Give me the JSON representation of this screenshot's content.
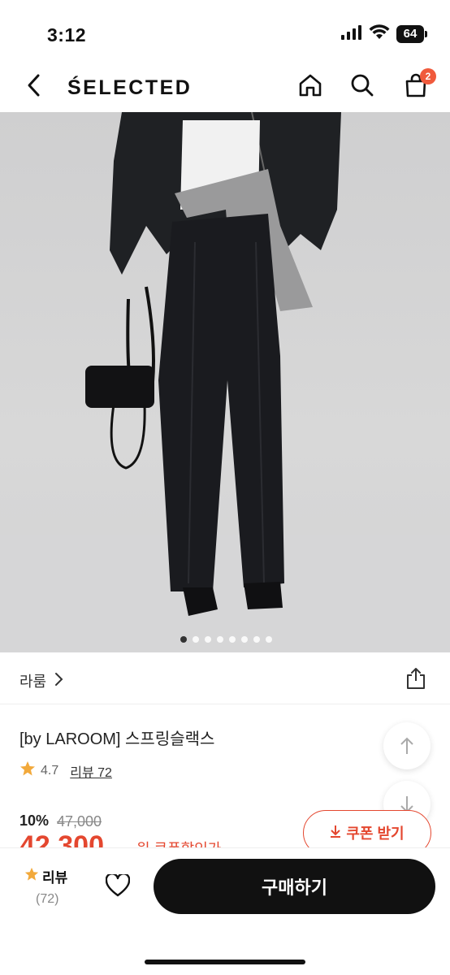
{
  "status": {
    "time": "3:12",
    "battery": "64",
    "icons": [
      "signal-icon",
      "wifi-icon",
      "battery-icon"
    ]
  },
  "header": {
    "logo": "ŚELECTED",
    "cart_count": "2",
    "icons": [
      "back-icon",
      "home-icon",
      "search-icon",
      "cart-icon"
    ]
  },
  "gallery": {
    "image_alt": "product photo: wide black slacks",
    "dot_count": 8,
    "active_index": 0
  },
  "product": {
    "brand": "라룸",
    "title": "[by LAROOM] 스프링슬랙스",
    "rating": "4.7",
    "review_link": "리뷰 72",
    "discount": "10%",
    "original_price": "47,000",
    "sale_price": "42,300",
    "sale_suffix": "원 쿠폰할인가",
    "coupon_label": "쿠폰 받기"
  },
  "bottom_bar": {
    "review_label": "리뷰",
    "review_count": "(72)",
    "buy_label": "구매하기"
  },
  "colors": {
    "accent": "#e4472f",
    "badge": "#f05a3c",
    "star": "#f2a93b",
    "buy_button": "#111111"
  }
}
